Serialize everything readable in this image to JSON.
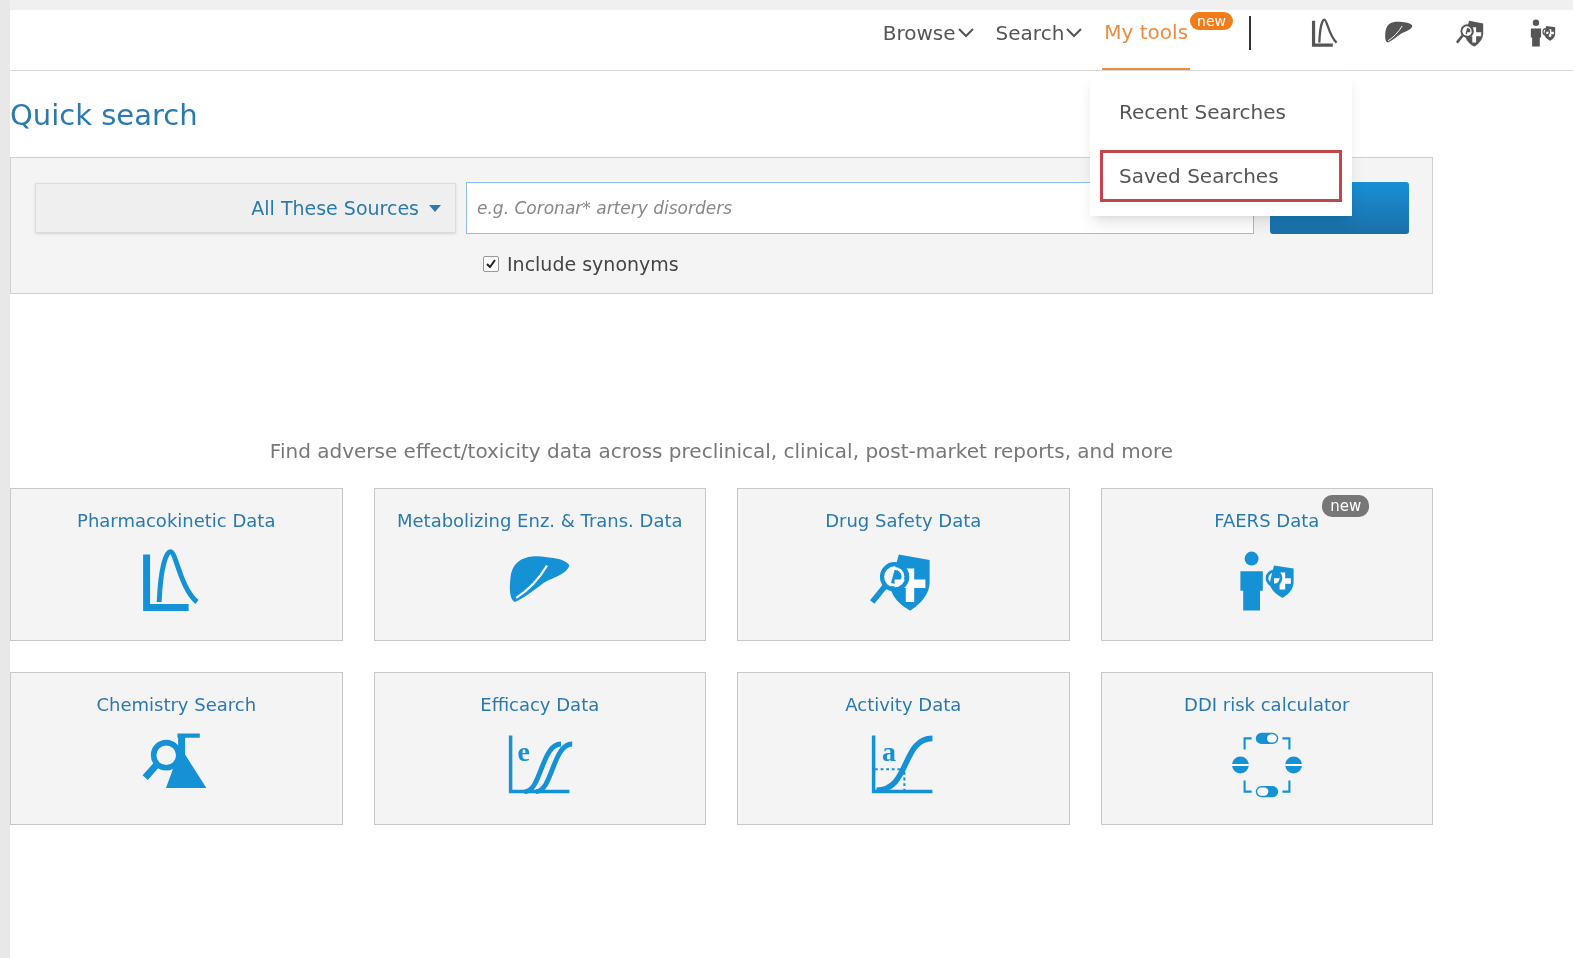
{
  "nav": {
    "items": [
      {
        "label": "Browse",
        "kind": "menu",
        "selected": false
      },
      {
        "label": "Search",
        "kind": "menu",
        "selected": false
      },
      {
        "label": "My tools",
        "kind": "tools",
        "selected": true,
        "badge": "new"
      }
    ],
    "icons": [
      {
        "kind": "pk"
      },
      {
        "kind": "liver"
      },
      {
        "kind": "safety"
      },
      {
        "kind": "faers"
      }
    ]
  },
  "dropdown": {
    "items": [
      {
        "label": "Recent Searches",
        "highlighted": false
      },
      {
        "label": "Saved Searches",
        "highlighted": true
      }
    ]
  },
  "title": "Quick search",
  "search": {
    "source": "All These Sources",
    "placeholder": "e.g. Coronar* artery disorders",
    "synonyms": {
      "label": "Include synonyms",
      "checked": true
    }
  },
  "tagline": "Find adverse effect/toxicity data across preclinical, clinical, post-market reports, and more",
  "cards": [
    {
      "label": "Pharmacokinetic Data",
      "kind": "pk"
    },
    {
      "label": "Metabolizing Enz. & Trans. Data",
      "kind": "liver"
    },
    {
      "label": "Drug Safety Data",
      "kind": "safety"
    },
    {
      "label": "FAERS Data",
      "kind": "faers",
      "badge": "new"
    },
    {
      "label": "Chemistry Search",
      "kind": "chem"
    },
    {
      "label": "Efficacy Data",
      "kind": "efficacy",
      "glyph": "e"
    },
    {
      "label": "Activity Data",
      "kind": "activity",
      "glyph": "a"
    },
    {
      "label": "DDI risk calculator",
      "kind": "ddi"
    }
  ]
}
